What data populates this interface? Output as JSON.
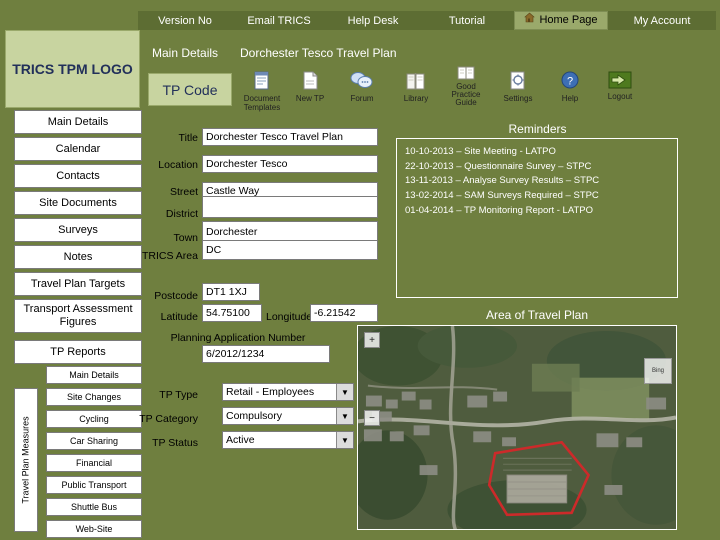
{
  "nav": {
    "tabs": [
      {
        "label": "Version No",
        "name": "tab-version-no"
      },
      {
        "label": "Email TRICS",
        "name": "tab-email-trics"
      },
      {
        "label": "Help Desk",
        "name": "tab-help-desk"
      },
      {
        "label": "Tutorial",
        "name": "tab-tutorial"
      },
      {
        "label": "Home Page",
        "name": "tab-home-page",
        "icon": "home-icon"
      },
      {
        "label": "My Account",
        "name": "tab-my-account"
      }
    ]
  },
  "logo": {
    "text": "TRICS TPM LOGO"
  },
  "header": {
    "section": "Main Details",
    "plan_name": "Dorchester Tesco Travel Plan",
    "tp_code_label": "TP Code"
  },
  "toolbar": [
    {
      "label": "Document Templates",
      "icon": "document-icon"
    },
    {
      "label": "New TP",
      "icon": "new-page-icon"
    },
    {
      "label": "Forum",
      "icon": "forum-icon"
    },
    {
      "label": "Library",
      "icon": "library-icon"
    },
    {
      "label": "Good Practice Guide",
      "icon": "guide-icon"
    },
    {
      "label": "Settings",
      "icon": "settings-icon"
    },
    {
      "label": "Help",
      "icon": "help-icon"
    },
    {
      "label": "Logout",
      "icon": "logout-icon"
    }
  ],
  "sidebar": {
    "items": [
      {
        "label": "Main Details",
        "name": "sidebar-item-main-details"
      },
      {
        "label": "Calendar",
        "name": "sidebar-item-calendar"
      },
      {
        "label": "Contacts",
        "name": "sidebar-item-contacts"
      },
      {
        "label": "Site Documents",
        "name": "sidebar-item-site-documents"
      },
      {
        "label": "Surveys",
        "name": "sidebar-item-surveys"
      },
      {
        "label": "Notes",
        "name": "sidebar-item-notes"
      },
      {
        "label": "Travel Plan Targets",
        "name": "sidebar-item-travel-plan-targets"
      },
      {
        "label": "Transport Assessment Figures",
        "name": "sidebar-item-transport-assessment-figures"
      },
      {
        "label": "TP Reports",
        "name": "sidebar-item-tp-reports"
      }
    ],
    "measures_label": "Travel Plan Measures",
    "measures": [
      {
        "label": "Main Details",
        "name": "measure-main-details"
      },
      {
        "label": "Site Changes",
        "name": "measure-site-changes"
      },
      {
        "label": "Cycling",
        "name": "measure-cycling"
      },
      {
        "label": "Car Sharing",
        "name": "measure-car-sharing"
      },
      {
        "label": "Financial",
        "name": "measure-financial"
      },
      {
        "label": "Public Transport",
        "name": "measure-public-transport"
      },
      {
        "label": "Shuttle Bus",
        "name": "measure-shuttle-bus"
      },
      {
        "label": "Web-Site",
        "name": "measure-web-site"
      }
    ]
  },
  "form": {
    "title": {
      "label": "Title",
      "value": "Dorchester Tesco Travel Plan"
    },
    "location": {
      "label": "Location",
      "value": "Dorchester Tesco"
    },
    "street": {
      "label": "Street",
      "value": "Castle Way"
    },
    "district": {
      "label": "District",
      "value": ""
    },
    "town": {
      "label": "Town",
      "value": "Dorchester"
    },
    "trics_area": {
      "label": "TRICS Area",
      "value": "DC"
    },
    "postcode": {
      "label": "Postcode",
      "value": "DT1 1XJ"
    },
    "latitude": {
      "label": "Latitude",
      "value": "54.75100"
    },
    "longitude": {
      "label": "Longitude",
      "value": "-6.21542"
    },
    "planning_application": {
      "label": "Planning Application Number",
      "value": "6/2012/1234"
    },
    "tp_type": {
      "label": "TP Type",
      "value": "Retail - Employees"
    },
    "tp_category": {
      "label": "TP Category",
      "value": "Compulsory"
    },
    "tp_status": {
      "label": "TP Status",
      "value": "Active"
    }
  },
  "reminders": {
    "title": "Reminders",
    "items": [
      "10-10-2013 – Site Meeting - LATPO",
      "22-10-2013 – Questionnaire Survey – STPC",
      "13-11-2013 – Analyse Survey Results – STPC",
      "13-02-2014 – SAM Surveys Required – STPC",
      "01-04-2014 – TP Monitoring Report - LATPO"
    ]
  },
  "map": {
    "title": "Area of Travel Plan",
    "zoom_in": "+",
    "zoom_out": "−",
    "logo_text": "Bing",
    "attribution": ""
  },
  "colors": {
    "background": "#6f7f3f",
    "tab": "#5d6d33",
    "panel": "#c8d4a0",
    "outline": "#cc2a2a"
  }
}
